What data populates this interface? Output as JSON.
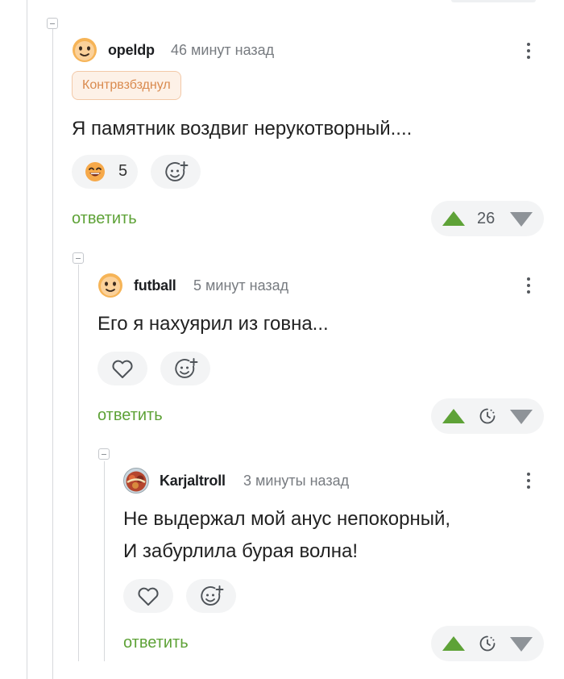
{
  "comments": [
    {
      "username": "opeldp",
      "time": "46 минут назад",
      "badge": "Контрвзбзднул",
      "text": "Я памятник воздвиг нерукотворный....",
      "reaction": {
        "icon": "grinning-emoji-icon",
        "count": "5"
      },
      "add_reaction_icon": "add-emoji-icon",
      "reply_label": "ответить",
      "rating": "26"
    },
    {
      "username": "futball",
      "time": "5 минут назад",
      "text": "Его я нахуярил из говна...",
      "like_icon": "heart-icon",
      "add_reaction_icon": "add-emoji-icon",
      "reply_label": "ответить",
      "rating_icon": "clock-icon"
    },
    {
      "username": "Karjaltroll",
      "time": "3 минуты назад",
      "text_lines": [
        "Не выдержал мой анус непокорный,",
        "И забурлила бурая волна!"
      ],
      "like_icon": "heart-icon",
      "add_reaction_icon": "add-emoji-icon",
      "reply_label": "ответить",
      "rating_icon": "clock-icon"
    }
  ],
  "colors": {
    "accent_green": "#5ea237",
    "badge_text": "#d98a4e",
    "muted_text": "#777b80",
    "thread_line": "#d7d9dc"
  }
}
